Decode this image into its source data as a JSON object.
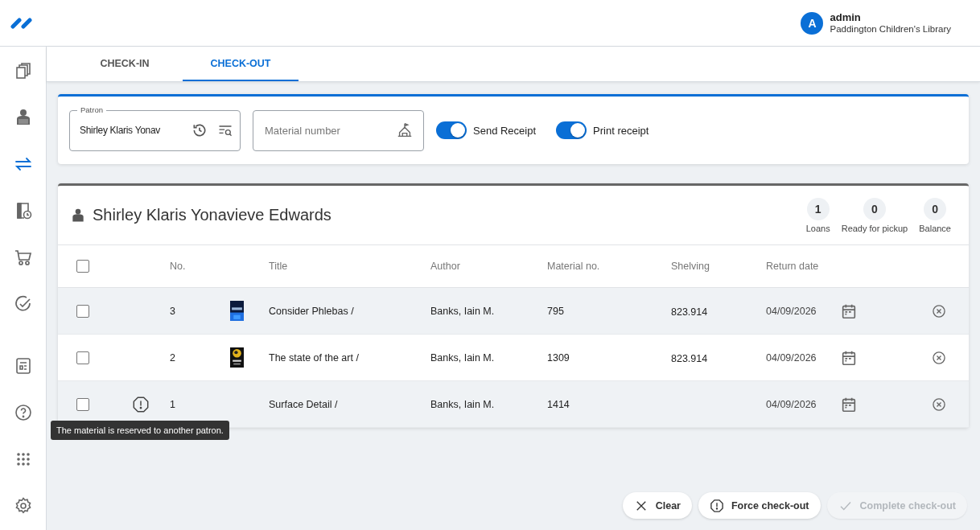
{
  "user": {
    "initial": "A",
    "name": "admin",
    "library": "Paddington Children's Library"
  },
  "sidebar": {
    "items": [
      {
        "kind": "copies",
        "selected": false
      },
      {
        "kind": "reader",
        "selected": false
      },
      {
        "kind": "swap",
        "selected": true
      },
      {
        "kind": "book-clock",
        "selected": false
      },
      {
        "kind": "cart",
        "selected": false
      },
      {
        "kind": "check",
        "selected": false
      },
      {
        "kind": "form",
        "selected": false
      },
      {
        "kind": "help",
        "selected": false
      },
      {
        "kind": "apps",
        "selected": false
      },
      {
        "kind": "settings",
        "selected": false
      }
    ]
  },
  "tabs": [
    {
      "label": "CHECK-IN",
      "selected": false
    },
    {
      "label": "CHECK-OUT",
      "selected": true
    }
  ],
  "form": {
    "patron": {
      "label": "Patron",
      "value": "Shirley Klaris Yonav"
    },
    "material": {
      "placeholder": "Material number"
    },
    "toggles": [
      {
        "label": "Send Receipt",
        "on": true
      },
      {
        "label": "Print receipt",
        "on": true
      }
    ]
  },
  "patron_card": {
    "name": "Shirley Klaris Yonavieve Edwards",
    "stats": [
      {
        "value": "1",
        "label": "Loans"
      },
      {
        "value": "0",
        "label": "Ready for pickup"
      },
      {
        "value": "0",
        "label": "Balance"
      }
    ]
  },
  "table": {
    "all_checked": false,
    "columns": [
      "No.",
      "Title",
      "Author",
      "Material no.",
      "Shelving",
      "Return date"
    ],
    "rows": [
      {
        "checked": false,
        "warning": false,
        "no": "3",
        "has_cover": true,
        "title": "Consider Phlebas /",
        "author": "Banks, Iain M.",
        "material_no": "795",
        "shelving": "823.914",
        "return_date": "04/09/2026"
      },
      {
        "checked": false,
        "warning": false,
        "no": "2",
        "has_cover": true,
        "title": "The state of the art /",
        "author": "Banks, Iain M.",
        "material_no": "1309",
        "shelving": "823.914",
        "return_date": "04/09/2026"
      },
      {
        "checked": false,
        "warning": true,
        "no": "1",
        "has_cover": false,
        "title": "Surface Detail /",
        "author": "Banks, Iain M.",
        "material_no": "1414",
        "return_date": "04/09/2026"
      }
    ]
  },
  "tooltip": "The material is reserved to another patron.",
  "actions": [
    {
      "kind": "clear",
      "label": "Clear",
      "disabled": false
    },
    {
      "kind": "force",
      "label": "Force check-out",
      "disabled": false
    },
    {
      "kind": "complete",
      "label": "Complete check-out",
      "disabled": true
    }
  ]
}
